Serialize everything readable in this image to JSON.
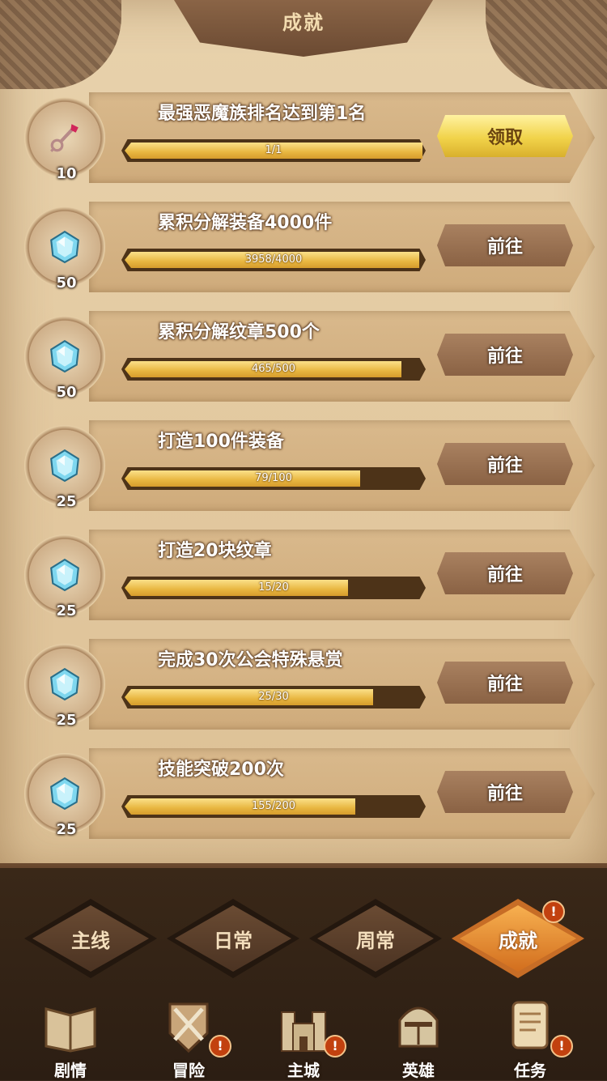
{
  "header": {
    "title": "成就"
  },
  "tasks": [
    {
      "name": "最强恶魔族排名达到第1名",
      "reward_icon": "key-icon",
      "reward_count": "10",
      "progress_text": "1/1",
      "progress": 1.0,
      "action_label": "领取",
      "action_type": "claim"
    },
    {
      "name": "累积分解装备4000件",
      "reward_icon": "diamond-icon",
      "reward_count": "50",
      "progress_text": "3958/4000",
      "progress": 0.9895,
      "action_label": "前往",
      "action_type": "go"
    },
    {
      "name": "累积分解纹章500个",
      "reward_icon": "diamond-icon",
      "reward_count": "50",
      "progress_text": "465/500",
      "progress": 0.93,
      "action_label": "前往",
      "action_type": "go"
    },
    {
      "name": "打造100件装备",
      "reward_icon": "diamond-icon",
      "reward_count": "25",
      "progress_text": "79/100",
      "progress": 0.79,
      "action_label": "前往",
      "action_type": "go"
    },
    {
      "name": "打造20块纹章",
      "reward_icon": "diamond-icon",
      "reward_count": "25",
      "progress_text": "15/20",
      "progress": 0.75,
      "action_label": "前往",
      "action_type": "go"
    },
    {
      "name": "完成30次公会特殊悬赏",
      "reward_icon": "diamond-icon",
      "reward_count": "25",
      "progress_text": "25/30",
      "progress": 0.8333,
      "action_label": "前往",
      "action_type": "go"
    },
    {
      "name": "技能突破200次",
      "reward_icon": "diamond-icon",
      "reward_count": "25",
      "progress_text": "155/200",
      "progress": 0.775,
      "action_label": "前往",
      "action_type": "go"
    }
  ],
  "tabs": [
    {
      "label": "主线",
      "active": false,
      "alert": false
    },
    {
      "label": "日常",
      "active": false,
      "alert": false
    },
    {
      "label": "周常",
      "active": false,
      "alert": false
    },
    {
      "label": "成就",
      "active": true,
      "alert": true
    }
  ],
  "nav": [
    {
      "label": "剧情",
      "icon": "book-icon",
      "alert": false
    },
    {
      "label": "冒险",
      "icon": "crossed-swords-icon",
      "alert": true
    },
    {
      "label": "主城",
      "icon": "castle-icon",
      "alert": true
    },
    {
      "label": "英雄",
      "icon": "helmet-icon",
      "alert": false
    },
    {
      "label": "任务",
      "icon": "scroll-icon",
      "alert": true
    }
  ],
  "alert_symbol": "!",
  "colors": {
    "accent": "#e58a2e",
    "progress_fill": "#e8b640",
    "claim_button": "#f1d34a",
    "alert": "#c2410f"
  }
}
